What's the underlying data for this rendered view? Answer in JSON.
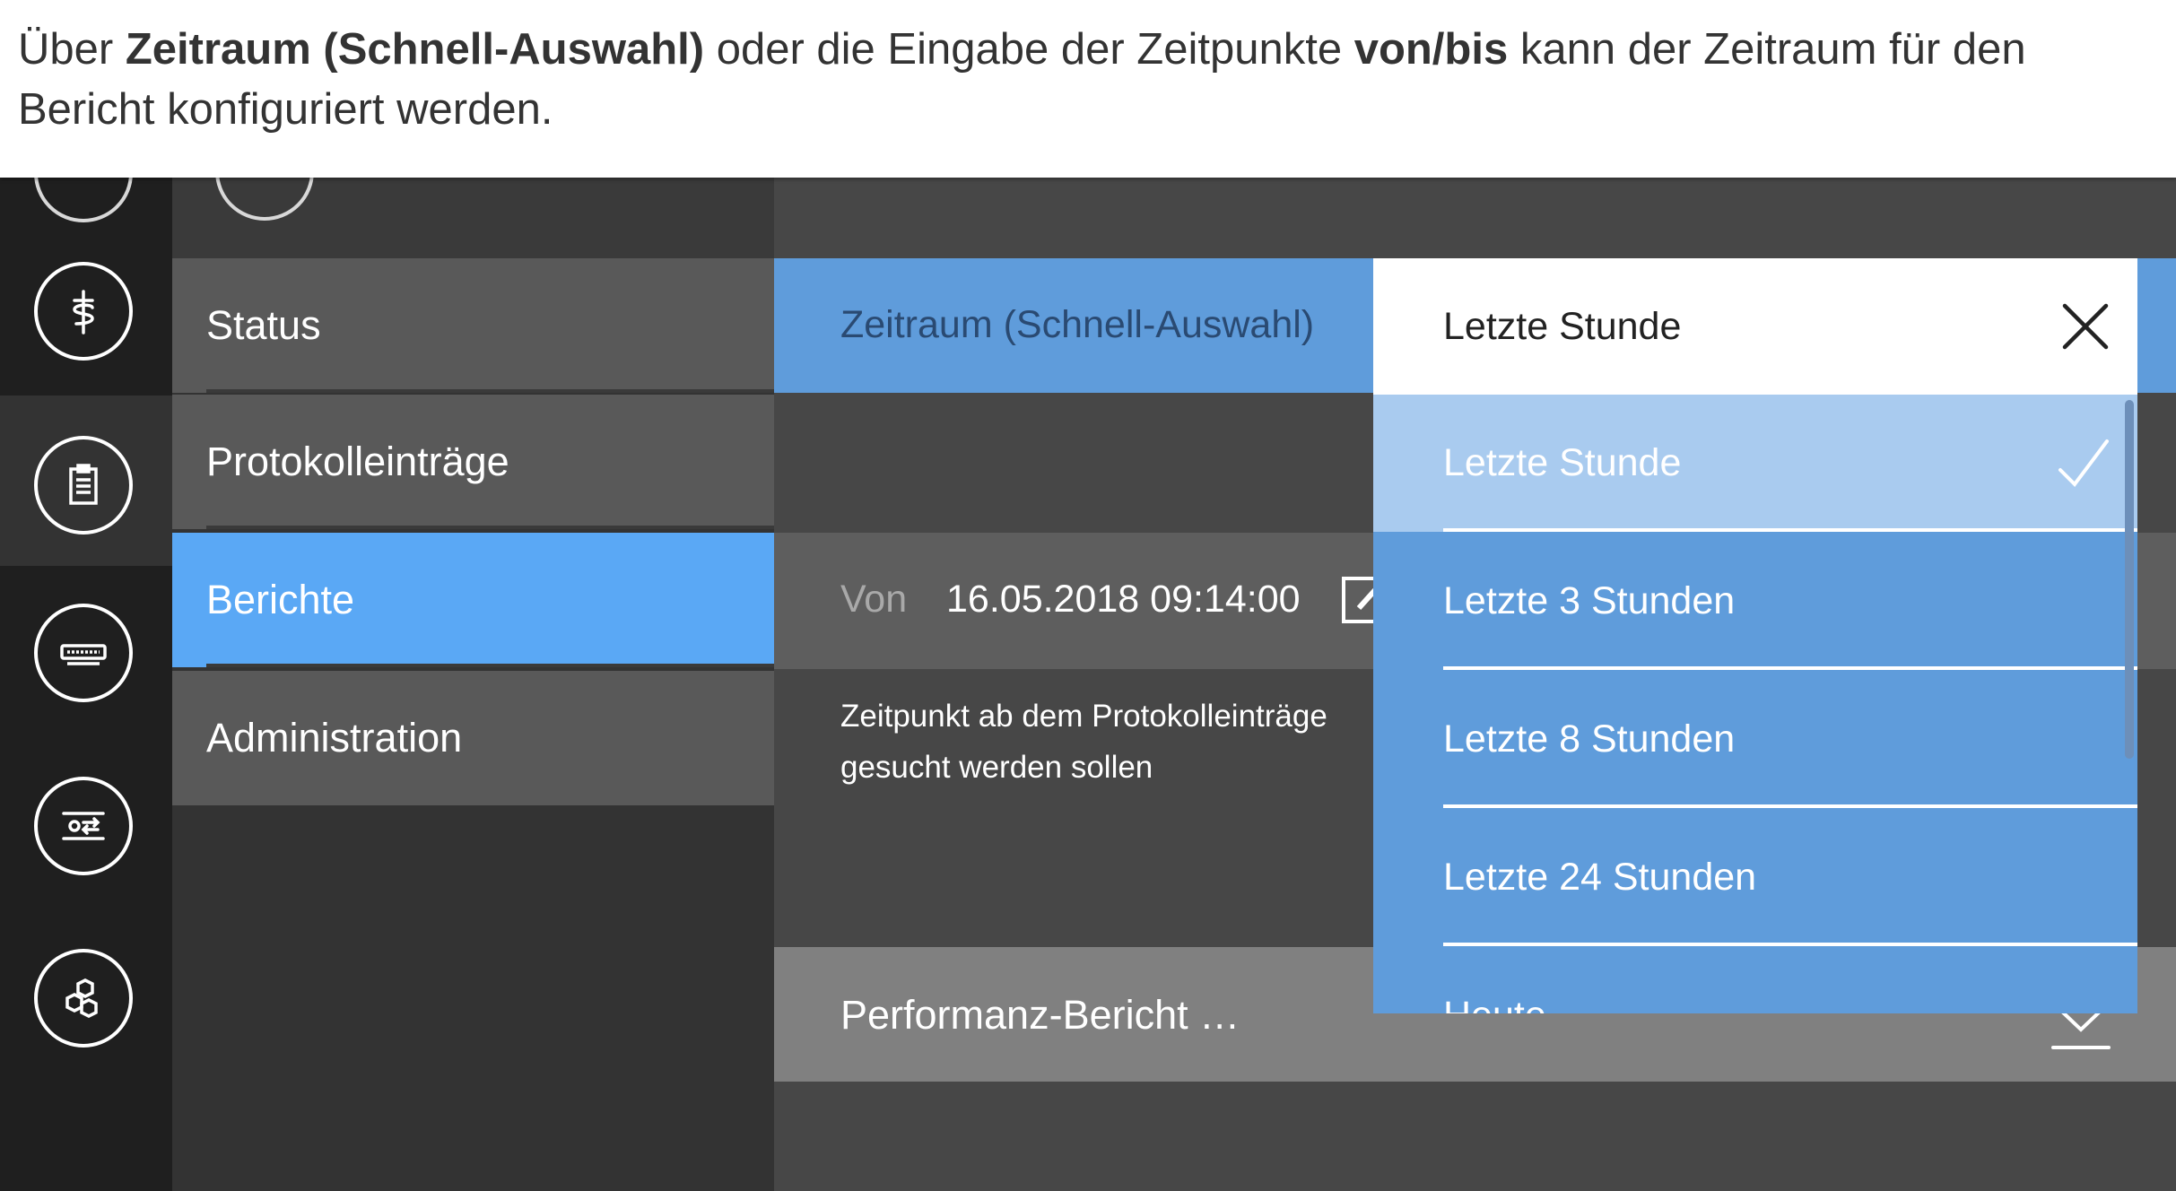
{
  "banner": {
    "pre": "Über ",
    "bold1": "Zeitraum (Schnell-Auswahl)",
    "mid": " oder die Eingabe der Zeitpunkte ",
    "bold2": "von/bis",
    "post": " kann der Zeitraum für den Bericht konfiguriert werden."
  },
  "rail": {
    "icons": [
      "medical-icon",
      "clipboard-icon",
      "device-icon",
      "settings-sliders-icon",
      "network-icon"
    ],
    "selected_index": 1
  },
  "nav": {
    "items": [
      {
        "label": "Status"
      },
      {
        "label": "Protokolleinträge"
      },
      {
        "label": "Berichte",
        "active": true
      },
      {
        "label": "Administration"
      }
    ]
  },
  "main": {
    "zeitraum_label": "Zeitraum (Schnell-Auswahl)",
    "von_label": "Von",
    "von_value": "16.05.2018 09:14:00",
    "hint": "Zeitpunkt ab dem Protokolleinträge gesucht werden sollen",
    "report_label": "Performanz-Bericht …"
  },
  "dropdown": {
    "selected": "Letzte Stunde",
    "options": [
      "Letzte Stunde",
      "Letzte 3 Stunden",
      "Letzte 8 Stunden",
      "Letzte 24 Stunden",
      "Heute"
    ]
  },
  "colors": {
    "accent_blue": "#5aa8f5",
    "dropdown_blue": "#5f9cdb",
    "selected_option": "#a9cbef"
  }
}
